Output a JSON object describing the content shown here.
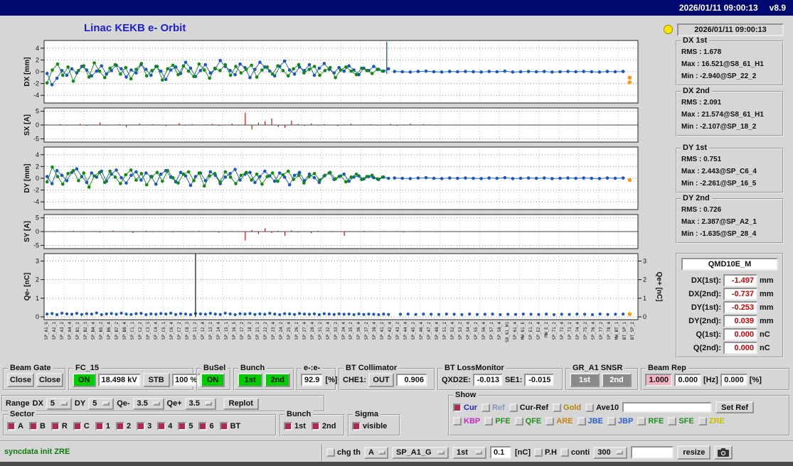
{
  "window": {
    "datetime": "2026/01/11 09:00:13",
    "version": "v8.9"
  },
  "header": {
    "title": "Linac KEKB e- Orbit",
    "timestamp": "2026/01/11 09:00:13"
  },
  "colors": {
    "on_green": "#00cd00",
    "value_red": "#cc0000",
    "rep_pink": "#f4b3c2",
    "series_blue": "#1a56c4",
    "series_green": "#0f8a0f",
    "steer_red": "#cc1111",
    "stray_orange": "#ff9900",
    "title_blue": "#2020cc",
    "led_yellow": "#ffe400"
  },
  "stats": {
    "groups": [
      {
        "label": "DX 1st",
        "rms": "RMS : 1.678",
        "max": "Max : 16.521@S8_61_H1",
        "min": "Min : -2.940@SP_22_2"
      },
      {
        "label": "DX 2nd",
        "rms": "RMS : 2.091",
        "max": "Max : 21.574@S8_61_H1",
        "min": "Min : -2.107@SP_18_2"
      },
      {
        "label": "DY 1st",
        "rms": "RMS : 0.751",
        "max": "Max : 2.443@SP_C6_4",
        "min": "Min : -2.261@SP_16_5"
      },
      {
        "label": "DY 2nd",
        "rms": "RMS : 0.726",
        "max": "Max : 2.387@SP_A2_1",
        "min": "Min : -1.635@SP_28_4"
      }
    ],
    "qmd": {
      "title": "QMD10E_M",
      "rows": [
        {
          "label": "DX(1st):",
          "value": "-1.497",
          "unit": "mm"
        },
        {
          "label": "DX(2nd):",
          "value": "-0.737",
          "unit": "mm"
        },
        {
          "label": "DY(1st):",
          "value": "-0.253",
          "unit": "mm"
        },
        {
          "label": "DY(2nd):",
          "value": "0.039",
          "unit": "mm"
        },
        {
          "label": "Q(1st):",
          "value": "0.000",
          "unit": "nC"
        },
        {
          "label": "Q(2nd):",
          "value": "0.000",
          "unit": "nC"
        }
      ]
    }
  },
  "row1": {
    "beam_gate": {
      "label": "Beam Gate",
      "close1": "Close",
      "close2": "Close"
    },
    "fc15": {
      "label": "FC_15",
      "on": "ON",
      "kv": "18.498 kV",
      "stb": "STB",
      "pct": "100 %"
    },
    "busel": {
      "label": "BuSel",
      "on": "ON"
    },
    "bunch": {
      "label": "Bunch",
      "b1": "1st",
      "b2": "2nd"
    },
    "ratio": {
      "label": "e-:e-",
      "value": "92.9",
      "unit": "[%]"
    },
    "bt_collimator": {
      "label": "BT Collimator",
      "che1": "CHE1:",
      "out": "OUT",
      "value": "0.906"
    },
    "bt_lossmonitor": {
      "label": "BT LossMonitor",
      "qxd2e": "QXD2E:",
      "v1": "-0.013",
      "se1": "SE1:",
      "v2": "-0.015"
    },
    "gr_snsr": {
      "label": "GR_A1 SNSR",
      "b1": "1st",
      "b2": "2nd"
    },
    "beam_rep": {
      "label": "Beam Rep",
      "v1": "1.000",
      "v2": "0.000",
      "hz": "[Hz]",
      "v3": "0.000",
      "pct": "[%]"
    }
  },
  "range_row": {
    "title": "Range",
    "dx_label": "DX",
    "dx": "5",
    "dy_label": "DY",
    "dy": "5",
    "qe_label": "Qe-",
    "qe": "3.5",
    "qep_label": "Qe+",
    "qep": "3.5",
    "replot": "Replot"
  },
  "show": {
    "title": "Show",
    "row1": [
      {
        "label": "Cur",
        "color": "#2222cc",
        "checked": true
      },
      {
        "label": "Ref",
        "color": "#8a97c0",
        "checked": false
      },
      {
        "label": "Cur-Ref",
        "color": "#111111",
        "checked": false
      },
      {
        "label": "Gold",
        "color": "#b8860b",
        "checked": false
      },
      {
        "label": "Ave10",
        "color": "#111111",
        "checked": false
      }
    ],
    "ref_input": "",
    "set_ref": "Set Ref",
    "row2": [
      {
        "label": "KBP",
        "color": "#cc22cc",
        "checked": false
      },
      {
        "label": "PFE",
        "color": "#1f8f1f",
        "checked": false
      },
      {
        "label": "QFE",
        "color": "#1f8f1f",
        "checked": false
      },
      {
        "label": "ARE",
        "color": "#d08000",
        "checked": false
      },
      {
        "label": "JBE",
        "color": "#2a5fd0",
        "checked": false
      },
      {
        "label": "JBP",
        "color": "#2a5fd0",
        "checked": false
      },
      {
        "label": "RFE",
        "color": "#1f8f1f",
        "checked": false
      },
      {
        "label": "SFE",
        "color": "#1f8f1f",
        "checked": false
      },
      {
        "label": "ZRE",
        "color": "#c3c300",
        "checked": false
      }
    ]
  },
  "sector": {
    "title": "Sector",
    "items": [
      "A",
      "B",
      "R",
      "C",
      "1",
      "2",
      "3",
      "4",
      "5",
      "6",
      "BT"
    ]
  },
  "bunch_sel": {
    "title": "Bunch",
    "items": [
      "1st",
      "2nd"
    ]
  },
  "sigma": {
    "title": "Sigma",
    "items": [
      "visible"
    ]
  },
  "statusbar": {
    "message": "syncdata init ZRE",
    "chg_th": "chg th",
    "sel_a": "A",
    "sel_bpm": "SP_A1_G",
    "sel_bunch": "1st",
    "threshold": "0.1",
    "threshold_unit": "[nC]",
    "ph": "P.H",
    "conti": "conti",
    "sel_rep": "300",
    "free_input": "",
    "resize": "resize"
  },
  "bpm_labels": [
    "SP_A1_G",
    "SP_A2_1",
    "SP_A3_2",
    "SP_A4_4",
    "SP_B1_2",
    "SP_B2_3",
    "SP_B4_4",
    "SP_B5_2",
    "SP_B6_4",
    "SP_B7_2",
    "SP_B8_4",
    "SP_C1_1",
    "SP_C2_2",
    "SP_C3_3",
    "SP_C4_4",
    "SP_C5_1",
    "SP_C6_4",
    "SP_C7_2",
    "SP_C8_3",
    "SP_11_2",
    "SP_12_4",
    "SP_13_2",
    "SP_14_4",
    "SP_15_1",
    "SP_16_5",
    "SP_17_2",
    "SP_18_2",
    "SP_21_2",
    "SP_22_2",
    "SP_23_4",
    "SP_24_2",
    "SP_25_4",
    "SP_26_2",
    "SP_27_4",
    "SP_28_4",
    "SP_31_2",
    "SP_32_4",
    "SP_33_2",
    "SP_34_4",
    "SP_35_2",
    "SP_36_4",
    "SP_37_2",
    "SP_38_4",
    "SP_41_2",
    "SP_42_4",
    "SP_43_2",
    "SP_44_4",
    "SP_45_2",
    "SP_46_4",
    "SP_47_2",
    "SP_48_4",
    "SP_51_2",
    "SP_52_4",
    "SP_53_2",
    "SP_54_4",
    "SP_55_2",
    "SP_56_4",
    "SP_57_2",
    "SP_58_4",
    "S8_61_H1",
    "SP_61_4",
    "MW_61_E",
    "SP_E1_2",
    "SP_E2_4",
    "MW_E_2",
    "SP_71_2",
    "SP_72_4",
    "SP_73_2",
    "SP_74_4",
    "SP_75_2",
    "SP_76_4",
    "SP_77_2",
    "SP_78_4",
    "MW_BT_1",
    "BT_SP_1",
    "BT_SP_2"
  ],
  "chart_data": [
    {
      "id": "dx",
      "type": "scatter",
      "ylabel": "DX [mm]",
      "ylim": [
        -5.3,
        5.3
      ],
      "yticks": [
        -4,
        -2,
        0,
        2,
        4
      ],
      "series": [
        {
          "name": "DX 1st bunch",
          "color": "#1a56c4",
          "x0": 0.005,
          "x1": 0.58,
          "connect": true,
          "y": [
            -0.3,
            -2.2,
            -1.1,
            0.2,
            -0.6,
            0.5,
            -0.2,
            0.9,
            0.3,
            -0.7,
            0.1,
            1.0,
            -0.4,
            0.2,
            1.1,
            0.5,
            -0.9,
            0.3,
            -0.2,
            1.2,
            0.4,
            -0.6,
            0.9,
            0.1,
            -1.3,
            0.3,
            0.8,
            -0.3,
            1.6,
            0.6,
            -0.8,
            0.2,
            1.2,
            -0.2,
            0.5,
            1.9,
            0.9,
            0.2,
            -0.5,
            1.3,
            0.7,
            -1.0,
            0.4,
            1.6,
            0.8,
            0.1,
            -0.7,
            0.9,
            1.8,
            0.3,
            -0.4,
            0.8,
            0.2,
            1.2,
            -0.6,
            0.6,
            1.4,
            0.4,
            -0.2,
            0.7,
            0.1,
            1.0,
            0.3,
            -0.5,
            0.6,
            0.2,
            0.9,
            0.4,
            0.1,
            0.5
          ]
        },
        {
          "name": "DX 1st bunch tail",
          "color": "#1a56c4",
          "x0": 0.59,
          "x1": 0.975,
          "connect": true,
          "y": [
            0.05,
            0.0,
            -0.05,
            0.05,
            0.1,
            0.0,
            -0.05,
            0.05,
            0.0,
            0.05,
            0.0,
            -0.05,
            0.05,
            0.0,
            0.1,
            -0.05,
            0.0,
            0.05,
            0.0,
            0.05,
            -0.05,
            0.0,
            0.05,
            0.0,
            0.05,
            0.0,
            -0.05,
            0.05,
            0.0,
            0.05
          ]
        },
        {
          "name": "DX 2nd bunch",
          "color": "#0f8a0f",
          "x0": 0.005,
          "x1": 0.57,
          "connect": true,
          "y": [
            -1.9,
            0.3,
            1.3,
            -0.6,
            0.8,
            -1.6,
            0.2,
            1.0,
            -0.9,
            1.5,
            0.1,
            -1.0,
            0.6,
            1.2,
            -0.4,
            0.7,
            -1.2,
            0.4,
            1.4,
            -0.7,
            0.2,
            0.9,
            -1.4,
            0.5,
            1.1,
            -0.5,
            1.0,
            0.1,
            -0.8,
            1.3,
            0.3,
            -1.1,
            0.6,
            0.2,
            1.2,
            -0.6,
            0.9,
            -0.2,
            0.4,
            1.1,
            -0.9,
            0.3,
            0.8,
            -0.4,
            1.0,
            0.2,
            -0.7,
            0.5,
            1.2,
            -0.2,
            0.4,
            0.9,
            -0.6,
            0.2,
            0.7,
            -1.0,
            0.3,
            0.8,
            0.1,
            -0.5,
            0.6,
            0.2,
            -0.3,
            0.4,
            0.1
          ]
        }
      ],
      "vlines": [
        {
          "x": 0.577,
          "y0": -0.4,
          "y1": 5.1,
          "color": "#1a56c4"
        }
      ],
      "markers": [
        {
          "x": 0.986,
          "y": -1.0,
          "color": "#ff9900"
        },
        {
          "x": 0.986,
          "y": -1.8,
          "color": "#ff9900"
        }
      ]
    },
    {
      "id": "sx",
      "type": "bars",
      "ylabel": "SX [A]",
      "color": "#cc1111",
      "ylim": [
        -6.2,
        6.2
      ],
      "yticks": [
        -5,
        0,
        5
      ],
      "x0": 0.005,
      "x1": 0.995,
      "values": [
        0.2,
        -0.1,
        0.3,
        -0.2,
        0.1,
        0.4,
        -0.3,
        0.2,
        0.9,
        -0.2,
        0.1,
        0.3,
        -0.8,
        0.2,
        0.5,
        -0.1,
        0.3,
        0.2,
        -0.4,
        0.1,
        0.7,
        -0.2,
        0.3,
        -0.1,
        0.2,
        0.4,
        -0.3,
        0.1,
        0.5,
        -0.2,
        4.5,
        -1.6,
        0.9,
        1.4,
        2.4,
        -0.7,
        -1.0,
        1.6,
        0.4,
        -0.3,
        0.6,
        -0.2,
        0.3,
        0.1,
        -0.4,
        0.2,
        0.5,
        -0.1,
        0.2,
        0.3,
        -0.2,
        0.1,
        0.4,
        -0.3,
        0.2,
        0.5,
        -0.1,
        0.3,
        0.2,
        -0.2,
        0.1,
        0.0,
        0.1,
        -0.1,
        0.0,
        0.1,
        0.0,
        -0.1,
        0.1,
        0.0,
        0.1,
        -0.1,
        0.0,
        0.1,
        0.0,
        0.0,
        0.1,
        -0.1,
        0.0,
        0.1,
        0.0,
        -0.1,
        0.0,
        0.1,
        0.0,
        0.0,
        -0.1,
        0.1,
        0.0,
        0.1
      ]
    },
    {
      "id": "dy",
      "type": "scatter",
      "ylabel": "DY [mm]",
      "ylim": [
        -5.3,
        5.3
      ],
      "yticks": [
        -4,
        -2,
        0,
        2,
        4
      ],
      "series": [
        {
          "name": "DY 1st bunch",
          "color": "#1a56c4",
          "x0": 0.005,
          "x1": 0.58,
          "connect": true,
          "y": [
            0.3,
            -0.9,
            1.3,
            0.5,
            -0.4,
            1.0,
            1.6,
            0.3,
            -0.7,
            0.9,
            0.2,
            1.2,
            -0.5,
            0.7,
            1.4,
            0.1,
            -0.8,
            0.5,
            1.1,
            -0.3,
            0.9,
            0.3,
            -1.0,
            0.7,
            1.3,
            0.2,
            -0.6,
            1.0,
            0.4,
            -1.2,
            0.3,
            0.9,
            -0.4,
            1.1,
            0.5,
            -0.9,
            0.2,
            0.8,
            1.5,
            -0.3,
            0.7,
            1.0,
            -0.7,
            0.3,
            1.2,
            0.4,
            -0.5,
            0.9,
            0.2,
            -1.1,
            0.5,
            1.0,
            -0.4,
            0.7,
            0.1,
            -0.7,
            0.4,
            0.9,
            -0.2,
            0.3,
            0.7,
            -0.5,
            0.2,
            0.4,
            -0.1,
            0.3,
            0.1,
            -0.2,
            0.2,
            0.0
          ]
        },
        {
          "name": "DY 1st bunch tail",
          "color": "#1a56c4",
          "x0": 0.59,
          "x1": 0.975,
          "connect": true,
          "y": [
            0.05,
            0.0,
            -0.05,
            0.05,
            0.1,
            0.0,
            -0.05,
            0.05,
            0.0,
            0.05,
            0.0,
            -0.05,
            0.05,
            0.0,
            0.1,
            -0.05,
            0.0,
            0.05,
            0.0,
            0.05,
            -0.05,
            0.0,
            0.05,
            0.0,
            0.05,
            0.0,
            -0.05,
            0.05,
            0.0,
            0.05
          ]
        },
        {
          "name": "DY 2nd bunch",
          "color": "#0f8a0f",
          "x0": 0.005,
          "x1": 0.57,
          "connect": true,
          "y": [
            -0.6,
            1.9,
            0.3,
            -1.0,
            0.8,
            1.3,
            -0.4,
            0.9,
            -1.5,
            0.4,
            1.0,
            -0.7,
            1.2,
            0.2,
            -0.9,
            0.6,
            1.4,
            -0.3,
            0.8,
            -1.1,
            0.3,
            1.0,
            -0.5,
            1.3,
            0.1,
            -0.8,
            0.7,
            1.1,
            -0.4,
            0.9,
            -1.3,
            0.4,
            0.8,
            -0.6,
            1.1,
            0.2,
            -0.9,
            0.5,
            1.0,
            -0.3,
            0.7,
            -1.0,
            0.3,
            0.9,
            -0.5,
            0.6,
            1.2,
            -0.2,
            0.5,
            -0.8,
            0.3,
            0.8,
            -0.3,
            0.5,
            1.0,
            -0.1,
            0.4,
            -0.6,
            0.2,
            0.7,
            -0.2,
            0.3,
            0.5,
            -0.1,
            0.2
          ]
        }
      ],
      "markers": [
        {
          "x": 0.986,
          "y": -0.3,
          "color": "#ff9900"
        }
      ]
    },
    {
      "id": "sy",
      "type": "bars",
      "ylabel": "SY [A]",
      "color": "#cc1111",
      "ylim": [
        -6.2,
        6.2
      ],
      "yticks": [
        -5,
        0,
        5
      ],
      "x0": 0.005,
      "x1": 0.995,
      "values": [
        0.1,
        -0.2,
        0.2,
        -0.1,
        0.3,
        -0.2,
        0.1,
        0.2,
        -0.3,
        0.1,
        0.4,
        -0.2,
        0.2,
        -0.5,
        0.1,
        0.3,
        -0.2,
        0.2,
        0.1,
        -0.3,
        0.2,
        0.1,
        -0.2,
        0.3,
        -0.1,
        0.2,
        -0.4,
        0.1,
        0.2,
        -0.2,
        -3.2,
        0.6,
        -0.9,
        1.2,
        -0.5,
        0.3,
        -1.5,
        0.4,
        -0.3,
        0.2,
        -0.6,
        0.3,
        0.2,
        -0.2,
        0.1,
        -1.5,
        0.2,
        -0.1,
        0.3,
        -0.2,
        0.1,
        0.2,
        -0.1,
        0.2,
        -0.3,
        0.1,
        0.2,
        -0.1,
        0.1,
        -0.2,
        0.1,
        0.0,
        -0.1,
        0.1,
        0.0,
        -0.1,
        0.0,
        0.1,
        -0.1,
        0.0,
        0.1,
        0.0,
        -0.1,
        0.1,
        0.0,
        -0.1,
        0.0,
        0.1,
        0.0,
        -0.1,
        0.1,
        0.0,
        -0.1,
        0.0,
        0.1,
        -0.1,
        0.0,
        0.1,
        0.0,
        -0.1
      ]
    },
    {
      "id": "q",
      "type": "scatter",
      "ylabel": "Qe- [nC]",
      "ylabel_right": "Qe+ [nC]",
      "ylim": [
        -0.15,
        3.4
      ],
      "yticks": [
        0,
        1,
        2,
        3
      ],
      "yticks_right": [
        0,
        1,
        2,
        3
      ],
      "series": [
        {
          "name": "Qe- 1st bunch",
          "color": "#1a56c4",
          "x0": 0.005,
          "x1": 0.58,
          "connect": false,
          "r": 2.1,
          "y": [
            0.15,
            0.18,
            0.12,
            0.2,
            0.16,
            0.14,
            0.19,
            0.13,
            0.17,
            0.15,
            0.21,
            0.12,
            0.16,
            0.18,
            0.14,
            0.2,
            0.15,
            0.13,
            0.17,
            0.19,
            0.12,
            0.16,
            0.14,
            0.18,
            0.15,
            0.2,
            0.13,
            0.17,
            0.15,
            0.12,
            0.18,
            0.16,
            0.14,
            0.19,
            0.15,
            0.13,
            0.2,
            0.16,
            0.12,
            0.17,
            0.15,
            0.18,
            0.13,
            0.16,
            0.14,
            0.19,
            0.15,
            0.12,
            0.17,
            0.16,
            0.13,
            0.18,
            0.15,
            0.14,
            0.16,
            0.12,
            0.17,
            0.15,
            0.13,
            0.16,
            0.14,
            0.15,
            0.12,
            0.16,
            0.13,
            0.15,
            0.14,
            0.12,
            0.15,
            0.13
          ]
        },
        {
          "name": "Qe- 1st bunch tail",
          "color": "#1a56c4",
          "x0": 0.6,
          "x1": 0.975,
          "connect": false,
          "r": 2.1,
          "y": [
            0.14,
            0.15,
            0.13,
            0.15,
            0.14,
            0.13,
            0.15,
            0.14,
            0.12,
            0.15,
            0.13,
            0.14,
            0.15,
            0.12,
            0.14,
            0.13,
            0.15,
            0.14,
            0.13,
            0.15,
            0.12,
            0.14,
            0.13,
            0.15,
            0.14,
            0.12,
            0.15,
            0.13,
            0.14,
            0.15
          ]
        }
      ],
      "vlines": [
        {
          "x": 0.255,
          "y0": 0.0,
          "y1": 3.4,
          "color": "#222222"
        }
      ],
      "markers": [
        {
          "x": 0.986,
          "y": 0.15,
          "color": "#ff9900"
        }
      ]
    }
  ]
}
